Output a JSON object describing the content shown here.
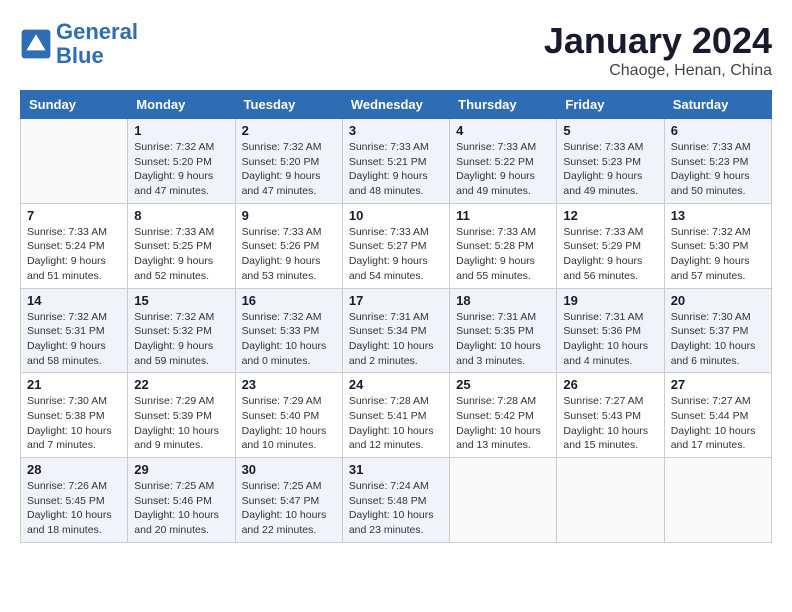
{
  "logo": {
    "line1": "General",
    "line2": "Blue"
  },
  "title": {
    "month_year": "January 2024",
    "location": "Chaoge, Henan, China"
  },
  "weekdays": [
    "Sunday",
    "Monday",
    "Tuesday",
    "Wednesday",
    "Thursday",
    "Friday",
    "Saturday"
  ],
  "weeks": [
    [
      {
        "day": "",
        "sunrise": "",
        "sunset": "",
        "daylight": ""
      },
      {
        "day": "1",
        "sunrise": "Sunrise: 7:32 AM",
        "sunset": "Sunset: 5:20 PM",
        "daylight": "Daylight: 9 hours and 47 minutes."
      },
      {
        "day": "2",
        "sunrise": "Sunrise: 7:32 AM",
        "sunset": "Sunset: 5:20 PM",
        "daylight": "Daylight: 9 hours and 47 minutes."
      },
      {
        "day": "3",
        "sunrise": "Sunrise: 7:33 AM",
        "sunset": "Sunset: 5:21 PM",
        "daylight": "Daylight: 9 hours and 48 minutes."
      },
      {
        "day": "4",
        "sunrise": "Sunrise: 7:33 AM",
        "sunset": "Sunset: 5:22 PM",
        "daylight": "Daylight: 9 hours and 49 minutes."
      },
      {
        "day": "5",
        "sunrise": "Sunrise: 7:33 AM",
        "sunset": "Sunset: 5:23 PM",
        "daylight": "Daylight: 9 hours and 49 minutes."
      },
      {
        "day": "6",
        "sunrise": "Sunrise: 7:33 AM",
        "sunset": "Sunset: 5:23 PM",
        "daylight": "Daylight: 9 hours and 50 minutes."
      }
    ],
    [
      {
        "day": "7",
        "sunrise": "Sunrise: 7:33 AM",
        "sunset": "Sunset: 5:24 PM",
        "daylight": "Daylight: 9 hours and 51 minutes."
      },
      {
        "day": "8",
        "sunrise": "Sunrise: 7:33 AM",
        "sunset": "Sunset: 5:25 PM",
        "daylight": "Daylight: 9 hours and 52 minutes."
      },
      {
        "day": "9",
        "sunrise": "Sunrise: 7:33 AM",
        "sunset": "Sunset: 5:26 PM",
        "daylight": "Daylight: 9 hours and 53 minutes."
      },
      {
        "day": "10",
        "sunrise": "Sunrise: 7:33 AM",
        "sunset": "Sunset: 5:27 PM",
        "daylight": "Daylight: 9 hours and 54 minutes."
      },
      {
        "day": "11",
        "sunrise": "Sunrise: 7:33 AM",
        "sunset": "Sunset: 5:28 PM",
        "daylight": "Daylight: 9 hours and 55 minutes."
      },
      {
        "day": "12",
        "sunrise": "Sunrise: 7:33 AM",
        "sunset": "Sunset: 5:29 PM",
        "daylight": "Daylight: 9 hours and 56 minutes."
      },
      {
        "day": "13",
        "sunrise": "Sunrise: 7:32 AM",
        "sunset": "Sunset: 5:30 PM",
        "daylight": "Daylight: 9 hours and 57 minutes."
      }
    ],
    [
      {
        "day": "14",
        "sunrise": "Sunrise: 7:32 AM",
        "sunset": "Sunset: 5:31 PM",
        "daylight": "Daylight: 9 hours and 58 minutes."
      },
      {
        "day": "15",
        "sunrise": "Sunrise: 7:32 AM",
        "sunset": "Sunset: 5:32 PM",
        "daylight": "Daylight: 9 hours and 59 minutes."
      },
      {
        "day": "16",
        "sunrise": "Sunrise: 7:32 AM",
        "sunset": "Sunset: 5:33 PM",
        "daylight": "Daylight: 10 hours and 0 minutes."
      },
      {
        "day": "17",
        "sunrise": "Sunrise: 7:31 AM",
        "sunset": "Sunset: 5:34 PM",
        "daylight": "Daylight: 10 hours and 2 minutes."
      },
      {
        "day": "18",
        "sunrise": "Sunrise: 7:31 AM",
        "sunset": "Sunset: 5:35 PM",
        "daylight": "Daylight: 10 hours and 3 minutes."
      },
      {
        "day": "19",
        "sunrise": "Sunrise: 7:31 AM",
        "sunset": "Sunset: 5:36 PM",
        "daylight": "Daylight: 10 hours and 4 minutes."
      },
      {
        "day": "20",
        "sunrise": "Sunrise: 7:30 AM",
        "sunset": "Sunset: 5:37 PM",
        "daylight": "Daylight: 10 hours and 6 minutes."
      }
    ],
    [
      {
        "day": "21",
        "sunrise": "Sunrise: 7:30 AM",
        "sunset": "Sunset: 5:38 PM",
        "daylight": "Daylight: 10 hours and 7 minutes."
      },
      {
        "day": "22",
        "sunrise": "Sunrise: 7:29 AM",
        "sunset": "Sunset: 5:39 PM",
        "daylight": "Daylight: 10 hours and 9 minutes."
      },
      {
        "day": "23",
        "sunrise": "Sunrise: 7:29 AM",
        "sunset": "Sunset: 5:40 PM",
        "daylight": "Daylight: 10 hours and 10 minutes."
      },
      {
        "day": "24",
        "sunrise": "Sunrise: 7:28 AM",
        "sunset": "Sunset: 5:41 PM",
        "daylight": "Daylight: 10 hours and 12 minutes."
      },
      {
        "day": "25",
        "sunrise": "Sunrise: 7:28 AM",
        "sunset": "Sunset: 5:42 PM",
        "daylight": "Daylight: 10 hours and 13 minutes."
      },
      {
        "day": "26",
        "sunrise": "Sunrise: 7:27 AM",
        "sunset": "Sunset: 5:43 PM",
        "daylight": "Daylight: 10 hours and 15 minutes."
      },
      {
        "day": "27",
        "sunrise": "Sunrise: 7:27 AM",
        "sunset": "Sunset: 5:44 PM",
        "daylight": "Daylight: 10 hours and 17 minutes."
      }
    ],
    [
      {
        "day": "28",
        "sunrise": "Sunrise: 7:26 AM",
        "sunset": "Sunset: 5:45 PM",
        "daylight": "Daylight: 10 hours and 18 minutes."
      },
      {
        "day": "29",
        "sunrise": "Sunrise: 7:25 AM",
        "sunset": "Sunset: 5:46 PM",
        "daylight": "Daylight: 10 hours and 20 minutes."
      },
      {
        "day": "30",
        "sunrise": "Sunrise: 7:25 AM",
        "sunset": "Sunset: 5:47 PM",
        "daylight": "Daylight: 10 hours and 22 minutes."
      },
      {
        "day": "31",
        "sunrise": "Sunrise: 7:24 AM",
        "sunset": "Sunset: 5:48 PM",
        "daylight": "Daylight: 10 hours and 23 minutes."
      },
      {
        "day": "",
        "sunrise": "",
        "sunset": "",
        "daylight": ""
      },
      {
        "day": "",
        "sunrise": "",
        "sunset": "",
        "daylight": ""
      },
      {
        "day": "",
        "sunrise": "",
        "sunset": "",
        "daylight": ""
      }
    ]
  ]
}
